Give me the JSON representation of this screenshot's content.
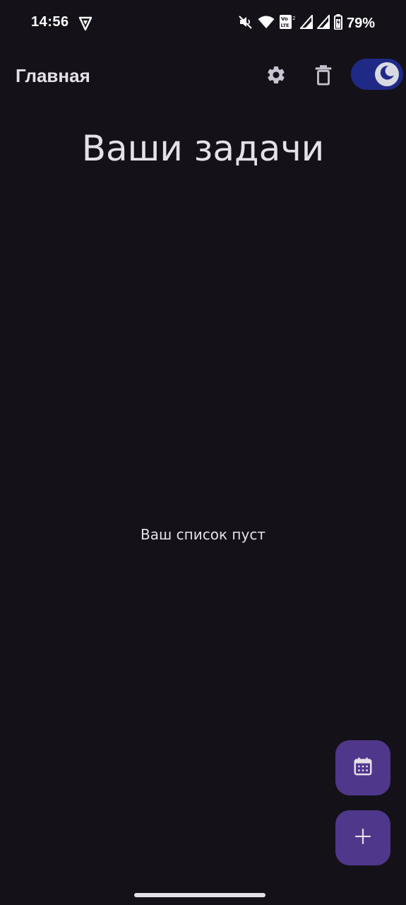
{
  "status_bar": {
    "time": "14:56",
    "battery_percent": "79%",
    "icons": [
      "vpn-icon",
      "mute-icon",
      "wifi-icon",
      "volte-icon",
      "signal-icon",
      "signal-icon-2",
      "battery-icon"
    ]
  },
  "app_bar": {
    "title": "Главная",
    "settings_icon": "gear-icon",
    "delete_icon": "trash-icon",
    "dark_mode_on": true
  },
  "main": {
    "heading": "Ваши задачи",
    "empty_message": "Ваш список пуст"
  },
  "fabs": {
    "calendar_icon": "calendar-icon",
    "add_icon": "plus-icon"
  },
  "colors": {
    "background": "#141218",
    "fab": "#4f378b",
    "switch_track": "#1f2a87",
    "text": "#e6e0e9"
  }
}
